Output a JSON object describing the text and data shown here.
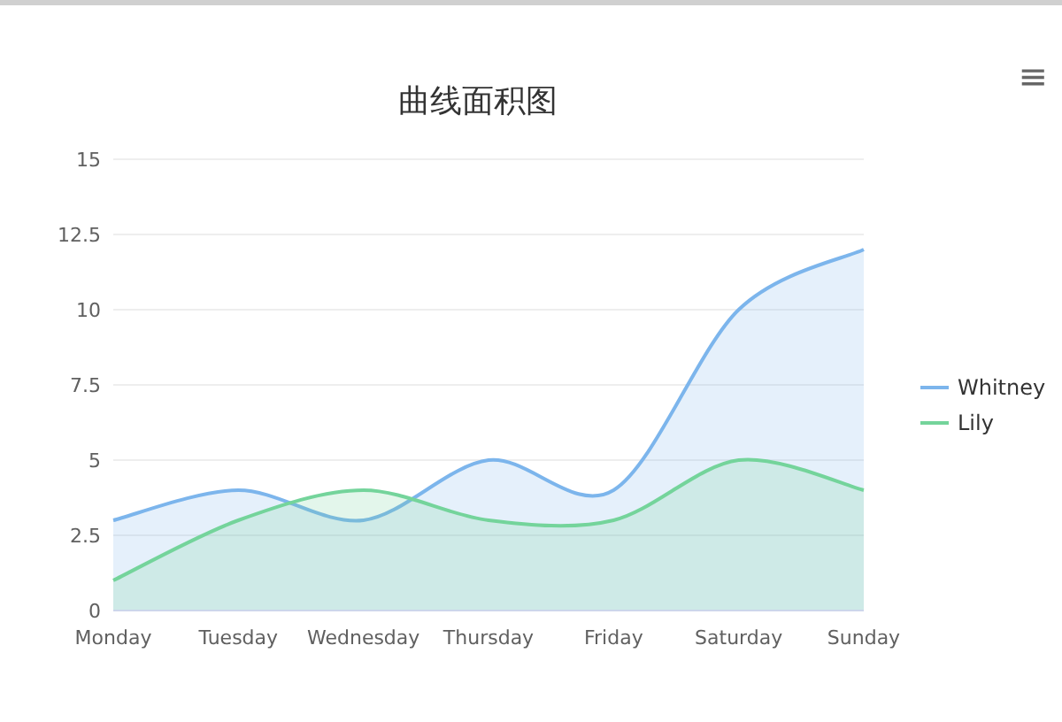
{
  "chart": {
    "menu_icon": "≡",
    "chart_data": {
      "type": "area",
      "title": "曲线面积图",
      "categories": [
        "Monday",
        "Tuesday",
        "Wednesday",
        "Thursday",
        "Friday",
        "Saturday",
        "Sunday"
      ],
      "grid": true,
      "legend": true,
      "ylim": [
        0,
        15
      ],
      "yticks": [
        0,
        {
          "value": 2.5,
          "label": "2.5"
        },
        5,
        {
          "value": 7.5,
          "label": "7.5"
        },
        10,
        {
          "value": 12.5,
          "label": "12.5"
        },
        15
      ],
      "series": [
        {
          "name": "Whitney",
          "color": "#7cb5ec",
          "values": [
            3,
            4,
            3,
            5,
            4,
            10,
            12
          ]
        },
        {
          "name": "Lily",
          "color": "#74d49b",
          "values": [
            1,
            3,
            4,
            3,
            3,
            5,
            4
          ]
        }
      ]
    }
  }
}
